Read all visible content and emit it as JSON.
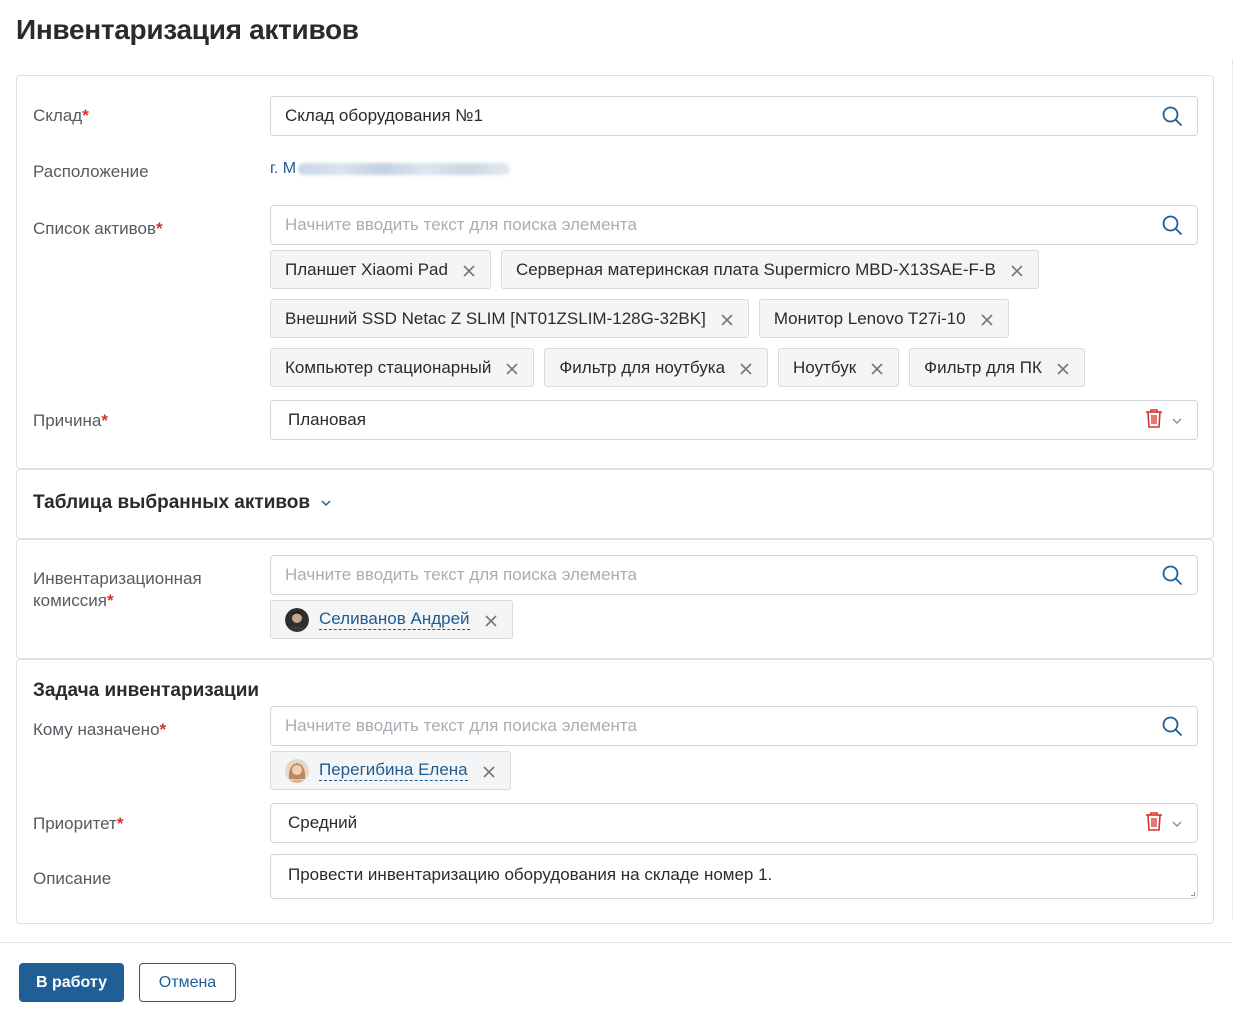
{
  "page": {
    "title": "Инвентаризация активов"
  },
  "main_section": {
    "warehouse": {
      "label": "Склад",
      "value": "Склад оборудования №1"
    },
    "location": {
      "label": "Расположение",
      "value": "г. М"
    },
    "assets": {
      "label": "Список активов",
      "placeholder": "Начните вводить текст для поиска элемента",
      "rows": [
        [
          "Планшет Xiaomi Pad",
          "Серверная материнская плата Supermicro MBD-X13SAE-F-B"
        ],
        [
          "Внешний SSD Netac Z SLIM [NT01ZSLIM-128G-32BK]",
          "Монитор Lenovo T27i-10"
        ],
        [
          "Компьютер стационарный",
          "Фильтр для ноутбука",
          "Ноутбук",
          "Фильтр для ПК"
        ]
      ]
    },
    "reason": {
      "label": "Причина",
      "value": "Плановая"
    }
  },
  "assets_table": {
    "title": "Таблица выбранных активов"
  },
  "commission": {
    "label_line1": "Инвентаризационная",
    "label_line2": "комиссия",
    "placeholder": "Начните вводить текст для поиска элемента",
    "user": "Селиванов Андрей"
  },
  "task": {
    "title": "Задача инвентаризации",
    "assignee": {
      "label": "Кому назначено",
      "placeholder": "Начните вводить текст для поиска элемента",
      "user": "Перегибина Елена"
    },
    "priority": {
      "label": "Приоритет",
      "value": "Средний"
    },
    "description": {
      "label": "Описание",
      "value": "Провести инвентаризацию оборудования на складе номер 1."
    }
  },
  "footer": {
    "submit_label": "В работу",
    "cancel_label": "Отмена"
  },
  "colors": {
    "accent": "#1f5f96",
    "required": "#d9302c",
    "delete": "#d9302c",
    "link": "#1e5b8f"
  },
  "icons": [
    "search-icon",
    "close-icon",
    "trash-icon",
    "chevron-down-icon"
  ]
}
